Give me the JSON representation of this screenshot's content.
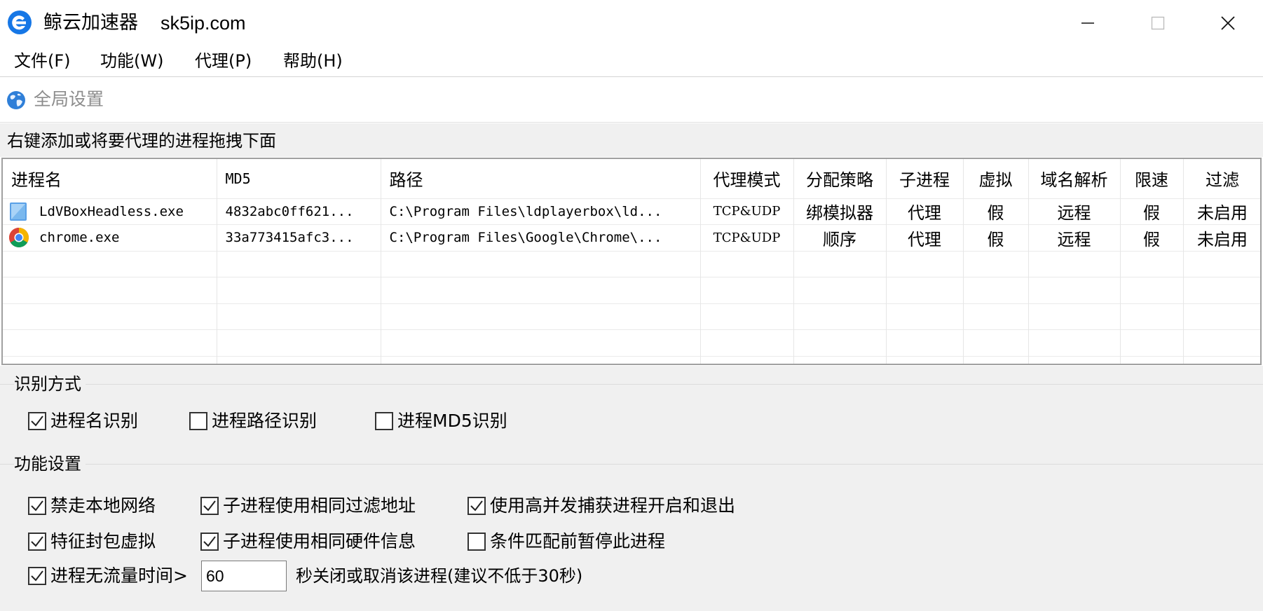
{
  "window": {
    "title": "鲸云加速器",
    "domain": "sk5ip.com",
    "icon": "e-letter-logo-icon",
    "minimize_icon": "minimize-icon",
    "maximize_icon": "maximize-icon",
    "close_icon": "close-icon"
  },
  "menu": [
    "文件(F)",
    "功能(W)",
    "代理(P)",
    "帮助(H)"
  ],
  "toolbar": {
    "global_settings": "全局设置",
    "icon": "globe-icon"
  },
  "hint": "右键添加或将要代理的进程拖拽下面",
  "table": {
    "headers": [
      "进程名",
      "MD5",
      "路径",
      "代理模式",
      "分配策略",
      "子进程",
      "虚拟",
      "域名解析",
      "限速",
      "过滤"
    ],
    "rows": [
      {
        "icon": "ldplayer-app-icon",
        "name": "LdVBoxHeadless.exe",
        "md5": "4832abc0ff621...",
        "path": "C:\\Program Files\\ldplayerbox\\ld...",
        "mode": "TCP&UDP",
        "strategy": "绑模拟器",
        "child": "代理",
        "virtual": "假",
        "dns": "远程",
        "limit": "假",
        "filter": "未启用"
      },
      {
        "icon": "chrome-icon",
        "name": "chrome.exe",
        "md5": "33a773415afc3...",
        "path": "C:\\Program Files\\Google\\Chrome\\...",
        "mode": "TCP&UDP",
        "strategy": "顺序",
        "child": "代理",
        "virtual": "假",
        "dns": "远程",
        "limit": "假",
        "filter": "未启用"
      }
    ]
  },
  "identify": {
    "title": "识别方式",
    "options": [
      {
        "label": "进程名识别",
        "checked": true
      },
      {
        "label": "进程路径识别",
        "checked": false
      },
      {
        "label": "进程MD5识别",
        "checked": false
      }
    ]
  },
  "features": {
    "title": "功能设置",
    "options": [
      {
        "label": "禁走本地网络",
        "checked": true
      },
      {
        "label": "子进程使用相同过滤地址",
        "checked": true
      },
      {
        "label": "使用高并发捕获进程开启和退出",
        "checked": true
      },
      {
        "label": "特征封包虚拟",
        "checked": true
      },
      {
        "label": "子进程使用相同硬件信息",
        "checked": true
      },
      {
        "label": "条件匹配前暂停此进程",
        "checked": false
      },
      {
        "label": "进程无流量时间>",
        "checked": true
      }
    ],
    "idle_seconds": "60",
    "idle_suffix": "秒关闭或取消该进程(建议不低于30秒)"
  }
}
